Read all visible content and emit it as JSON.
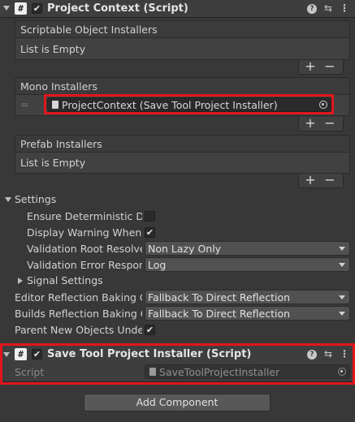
{
  "project_context": {
    "title": "Project Context (Script)",
    "enabled": true,
    "scriptable_installers": {
      "label": "Scriptable Object Installers",
      "empty": "List is Empty"
    },
    "mono_installers": {
      "label": "Mono Installers",
      "item": "ProjectContext (Save Tool Project Installer)"
    },
    "prefab_installers": {
      "label": "Prefab Installers",
      "empty": "List is Empty"
    },
    "add_glyph": "+",
    "remove_glyph": "−",
    "drag_handle": "="
  },
  "settings": {
    "label": "Settings",
    "ensure_deterministic": "Ensure Deterministic Des",
    "display_warning": "Display Warning When Re",
    "display_warning_checked": true,
    "validation_root_resolve": {
      "label": "Validation Root Resolve M",
      "value": "Non Lazy Only"
    },
    "validation_error_response": {
      "label": "Validation Error Response",
      "value": "Log"
    },
    "signal_settings": "Signal Settings",
    "editor_reflection": {
      "label": "Editor Reflection Baking Co",
      "value": "Fallback To Direct Reflection"
    },
    "builds_reflection": {
      "label": "Builds Reflection Baking Co",
      "value": "Fallback To Direct Reflection"
    },
    "parent_new_objects": "Parent New Objects Under (",
    "parent_new_objects_checked": true
  },
  "installer_component": {
    "title": "Save Tool Project Installer (Script)",
    "enabled": true,
    "script_label": "Script",
    "script_value": "SaveToolProjectInstaller"
  },
  "add_component": "Add Component",
  "icons": {
    "script": "#",
    "check": "✔",
    "help": "?",
    "presets": "⇆",
    "more": "⋮"
  },
  "colors": {
    "highlight_border": "#e0161c",
    "background": "#383838"
  }
}
